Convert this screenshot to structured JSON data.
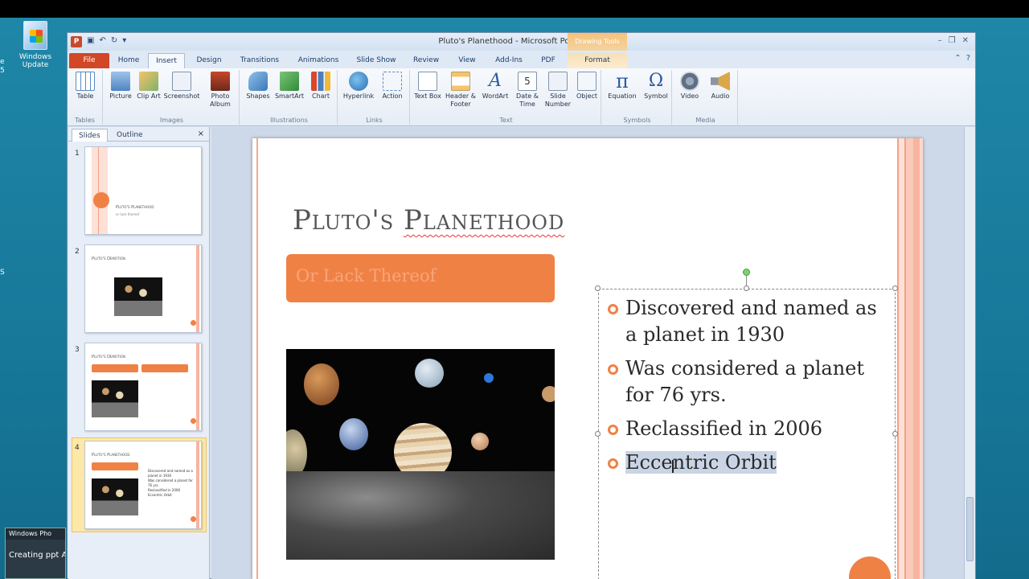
{
  "desktop": {
    "icon_label_line1": "Windows",
    "icon_label_line2": "Update",
    "edge_text_1": "e",
    "edge_text_2": "5",
    "edge_text_3": "S",
    "taskbar_thumb": {
      "caption": "Windows Pho",
      "body": "Creating ppt A"
    }
  },
  "window": {
    "title": "Pluto's Planethood - Microsoft PowerPoint",
    "contextual_header": "Drawing Tools",
    "tabs": [
      "File",
      "Home",
      "Insert",
      "Design",
      "Transitions",
      "Animations",
      "Slide Show",
      "Review",
      "View",
      "Add-Ins",
      "PDF",
      "Format"
    ],
    "active_tab": "Insert"
  },
  "ribbon": {
    "groups": [
      {
        "label": "Tables",
        "buttons": [
          "Table"
        ]
      },
      {
        "label": "Images",
        "buttons": [
          "Picture",
          "Clip Art",
          "Screenshot",
          "Photo Album"
        ]
      },
      {
        "label": "Illustrations",
        "buttons": [
          "Shapes",
          "SmartArt",
          "Chart"
        ]
      },
      {
        "label": "Links",
        "buttons": [
          "Hyperlink",
          "Action"
        ]
      },
      {
        "label": "Text",
        "buttons": [
          "Text Box",
          "Header & Footer",
          "WordArt",
          "Date & Time",
          "Slide Number",
          "Object"
        ]
      },
      {
        "label": "Symbols",
        "buttons": [
          "Equation",
          "Symbol"
        ]
      },
      {
        "label": "Media",
        "buttons": [
          "Video",
          "Audio"
        ]
      }
    ]
  },
  "pane": {
    "tabs": [
      "Slides",
      "Outline"
    ],
    "close": "×",
    "thumbnails": [
      {
        "num": "1",
        "title": "Pluto's Planethood",
        "sub": "or lack thereof"
      },
      {
        "num": "2",
        "title": "Pluto's Demotion"
      },
      {
        "num": "3",
        "title": "Pluto's Demotion"
      },
      {
        "num": "4",
        "title": "Pluto's Planethood",
        "bullets": [
          "Discovered and named as a planet in 1930",
          "Was considered a planet for 76 yrs.",
          "Reclassified in 2006",
          "Eccentric Orbit"
        ]
      }
    ],
    "selected": "4"
  },
  "slide": {
    "title_part1": "Pluto's",
    "title_part2": "Planethood",
    "subtitle": "Or Lack Thereof",
    "bullets": [
      "Discovered and named as a planet in 1930",
      "Was considered a planet for 76 yrs.",
      "Reclassified in 2006",
      "Eccentric Orbit"
    ],
    "selected_bullet_index": 3
  },
  "colors": {
    "accent": "#f08145",
    "file_tab": "#d24726",
    "ribbon_bg": "#e6edf6",
    "selection": "#c9d5e5"
  }
}
